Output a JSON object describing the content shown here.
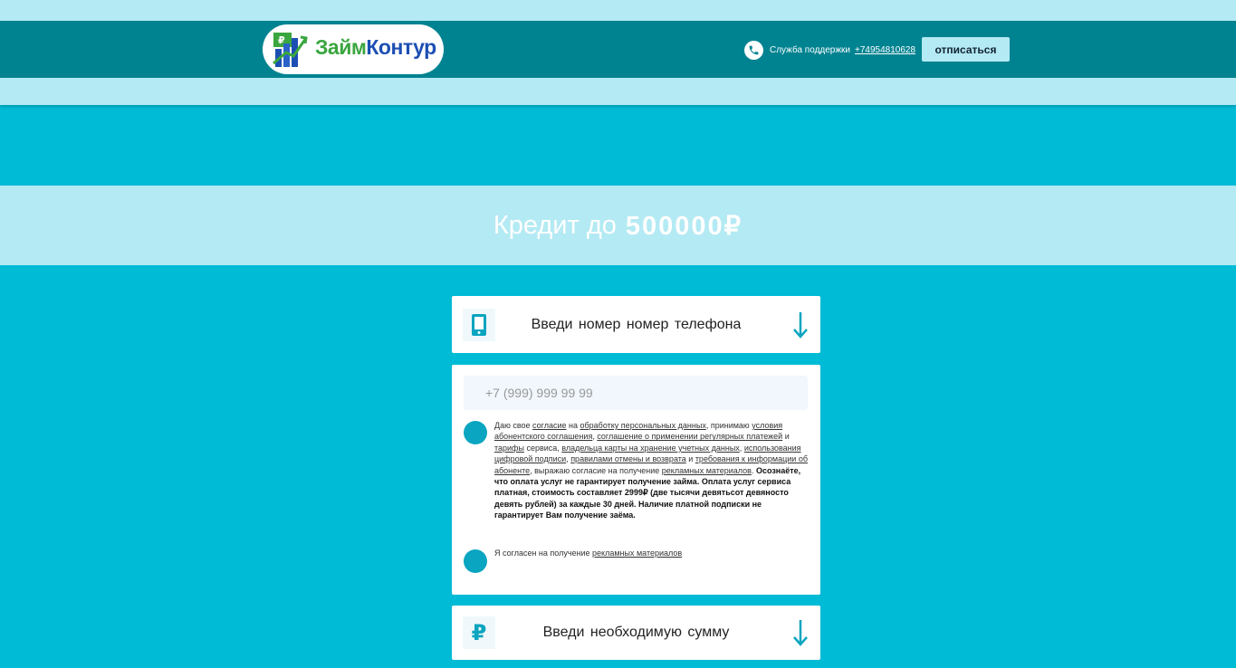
{
  "header": {
    "logo_part1": "Займ",
    "logo_part2": "Контур",
    "logo_badge": "₽",
    "support_label": "Служба поддержки",
    "support_phone": "+74954810628",
    "unsubscribe_label": "отписаться"
  },
  "banner": {
    "text": "Кредит до",
    "amount": "500000₽"
  },
  "steps": {
    "phone": {
      "title": "Введи номер номер телефона"
    },
    "amount": {
      "title": "Введи необходимую сумму",
      "icon_glyph": "₽"
    }
  },
  "form": {
    "phone_placeholder": "+7 (999) 999 99 99",
    "consent": {
      "t1": "Даю свое ",
      "l1": "согласие",
      "t2": " на ",
      "l2": "обработку персональных данных",
      "t3": ", принимаю ",
      "l3": "условия абонентского соглашения",
      "t4": ", ",
      "l4": "соглашение о применении регулярных платежей",
      "t5": " и ",
      "l5": "тарифы",
      "t6": " сервиса, ",
      "l6": "владельца карты на хранение учетных данных",
      "t7": ", ",
      "l7": "использования цифровой подписи",
      "t8": ", ",
      "l8": "правилами отмены и возврата",
      "t9": " и ",
      "l9": "требования к информации об абоненте",
      "t10": ", выражаю согласие на получение ",
      "l10": "рекламных материалов",
      "t11": ". ",
      "bold": "Осознаёте, что оплата услуг не гарантирует получение займа. Оплата услуг сервиса платная, стоимость составляет 2999₽ (две тысячи девятьсот девяносто девять рублей) за каждые 30 дней. Наличие платной подписки не гарантирует Вам получение заёма."
    },
    "consent2": {
      "text": "Я согласен на получение ",
      "link": "рекламных материалов"
    }
  },
  "colors": {
    "page_bg": "#00bbd6",
    "header_bg": "#008391",
    "light_band": "#b4eaf3",
    "accent": "#0aa5c0"
  },
  "icons": [
    "phone-icon",
    "smartphone-icon",
    "arrow-down-icon",
    "ruble-icon",
    "logo-chart-icon"
  ]
}
